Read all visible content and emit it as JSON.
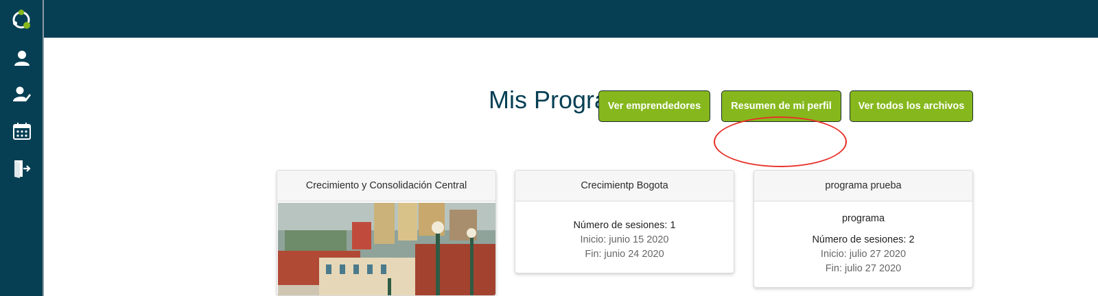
{
  "page": {
    "title": "Mis Programas"
  },
  "sidebar": {
    "items": [
      {
        "name": "profile",
        "icon": "user-icon"
      },
      {
        "name": "edit-profile",
        "icon": "user-edit-icon"
      },
      {
        "name": "calendar",
        "icon": "calendar-icon"
      },
      {
        "name": "logout",
        "icon": "logout-icon"
      }
    ]
  },
  "actions": {
    "ver_emprendedores": "Ver emprendedores",
    "resumen_perfil": "Resumen de mi perfil",
    "ver_archivos": "Ver todos los archivos"
  },
  "programs": [
    {
      "title": "Crecimiento y Consolidación Central",
      "has_image": true
    },
    {
      "title": "Crecimientp Bogota",
      "sessions": "Número de sesiones: 1",
      "start": "Inicio: junio 15 2020",
      "end": "Fin: junio 24 2020"
    },
    {
      "title": "programa prueba",
      "description": "programa",
      "sessions": "Número de sesiones: 2",
      "start": "Inicio: julio 27 2020",
      "end": "Fin: julio 27 2020"
    }
  ],
  "colors": {
    "navy": "#063f54",
    "accent_green": "#86b81d",
    "highlight_red": "#e8312a"
  }
}
